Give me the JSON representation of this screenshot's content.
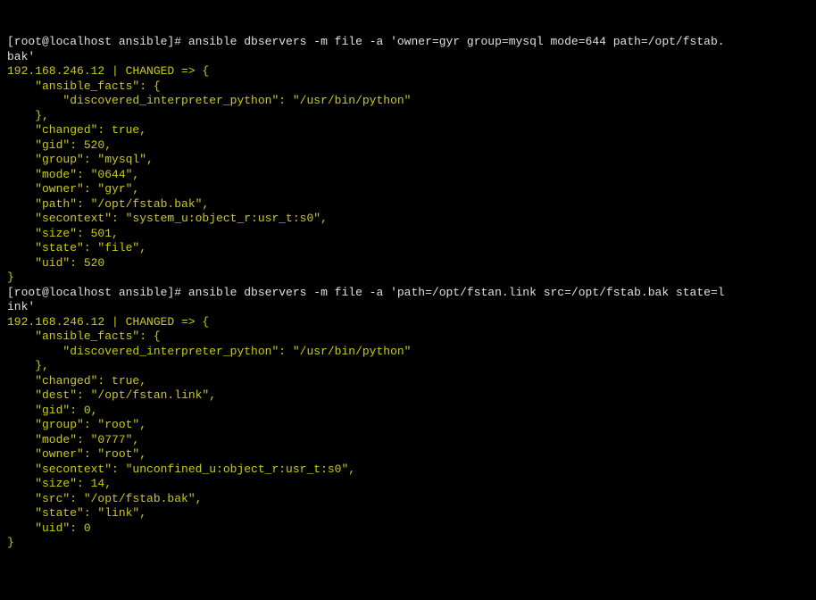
{
  "line1": {
    "prompt": "[root@localhost ansible]# ",
    "cmd": "ansible dbservers -m file -a 'owner=gyr group=mysql mode=644 path=/opt/fstab."
  },
  "line2": {
    "cmd": "bak'"
  },
  "line3": {
    "text": "192.168.246.12 | CHANGED => {"
  },
  "line4": {
    "text": "    \"ansible_facts\": {"
  },
  "line5": {
    "text": "        \"discovered_interpreter_python\": \"/usr/bin/python\""
  },
  "line6": {
    "text": "    }, "
  },
  "line7": {
    "text": "    \"changed\": true, "
  },
  "line8": {
    "text": "    \"gid\": 520, "
  },
  "line9": {
    "text": "    \"group\": \"mysql\", "
  },
  "line10": {
    "text": "    \"mode\": \"0644\", "
  },
  "line11": {
    "text": "    \"owner\": \"gyr\", "
  },
  "line12": {
    "text": "    \"path\": \"/opt/fstab.bak\", "
  },
  "line13": {
    "text": "    \"secontext\": \"system_u:object_r:usr_t:s0\", "
  },
  "line14": {
    "text": "    \"size\": 501, "
  },
  "line15": {
    "text": "    \"state\": \"file\", "
  },
  "line16": {
    "text": "    \"uid\": 520"
  },
  "line17": {
    "text": "}"
  },
  "line18": {
    "prompt": "[root@localhost ansible]# ",
    "cmd": "ansible dbservers -m file -a 'path=/opt/fstan.link src=/opt/fstab.bak state=l"
  },
  "line19": {
    "cmd": "ink'"
  },
  "line20": {
    "text": "192.168.246.12 | CHANGED => {"
  },
  "line21": {
    "text": "    \"ansible_facts\": {"
  },
  "line22": {
    "text": "        \"discovered_interpreter_python\": \"/usr/bin/python\""
  },
  "line23": {
    "text": "    }, "
  },
  "line24": {
    "text": "    \"changed\": true, "
  },
  "line25": {
    "text": "    \"dest\": \"/opt/fstan.link\", "
  },
  "line26": {
    "text": "    \"gid\": 0, "
  },
  "line27": {
    "text": "    \"group\": \"root\", "
  },
  "line28": {
    "text": "    \"mode\": \"0777\", "
  },
  "line29": {
    "text": "    \"owner\": \"root\", "
  },
  "line30": {
    "text": "    \"secontext\": \"unconfined_u:object_r:usr_t:s0\", "
  },
  "line31": {
    "text": "    \"size\": 14, "
  },
  "line32": {
    "text": "    \"src\": \"/opt/fstab.bak\", "
  },
  "line33": {
    "text": "    \"state\": \"link\", "
  },
  "line34": {
    "text": "    \"uid\": 0"
  },
  "line35": {
    "text": "}"
  }
}
